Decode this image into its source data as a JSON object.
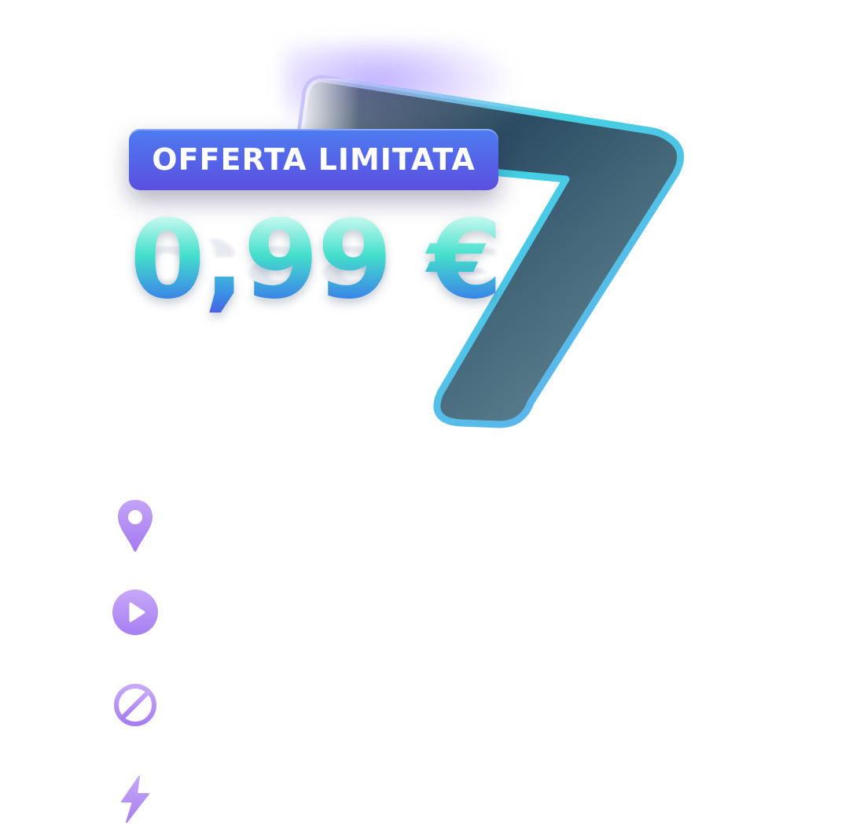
{
  "offer": {
    "badge_label": "OFFERTA LIMITATA",
    "price": "0,99 €"
  },
  "features": [
    {
      "icon": "location-pin-icon",
      "label": ""
    },
    {
      "icon": "play-icon",
      "label": ""
    },
    {
      "icon": "block-icon",
      "label": ""
    },
    {
      "icon": "lightning-icon",
      "label": ""
    }
  ],
  "colors": {
    "badge_top": "#4d7cf0",
    "badge_bottom": "#5b4fe0",
    "price_mint": "#45e0cc",
    "price_blue": "#3a86e6",
    "seven_fill": "#2b4a60",
    "seven_border": "#38c7da",
    "icon_purple": "#b48cf5"
  }
}
